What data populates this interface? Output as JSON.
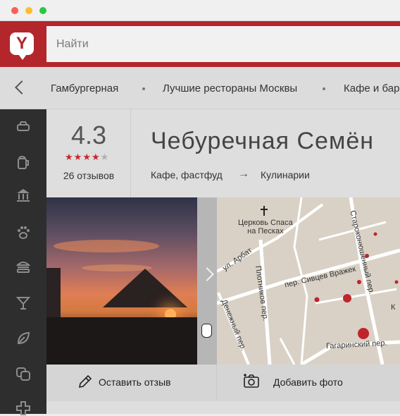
{
  "window": {
    "controls": [
      "close",
      "minimize",
      "maximize"
    ]
  },
  "header": {
    "logo_letter": "Y",
    "search_placeholder": "Найти",
    "brand_color": "#b3262b"
  },
  "breadcrumbs": {
    "items": [
      "Гамбургерная",
      "Лучшие рестораны Москвы",
      "Кафе и бар"
    ]
  },
  "sidebar": {
    "icons": [
      "car-icon",
      "beer-icon",
      "museum-icon",
      "paw-icon",
      "burger-icon",
      "cocktail-icon",
      "leaf-icon",
      "theater-icon",
      "plus-icon"
    ]
  },
  "place": {
    "rating": "4.3",
    "stars": {
      "filled": 4,
      "total": 5
    },
    "reviews": "26 отзывов",
    "title": "Чебуречная Семён",
    "category_from": "Кафе, фастфуд",
    "category_arrow": "→",
    "category_to": "Кулинарии"
  },
  "map": {
    "labels": {
      "church": "Церковь Спаса\nна Песках",
      "arbat": "ул. Арбат",
      "plotnikov": "Плотников пер.",
      "sivtsev": "пер. Сивцев Вражек",
      "denezhny": "Денежный пер.",
      "gagarinsky": "Гагаринский пер.",
      "starokonyush": "Староконюшенный пер.",
      "k": "К"
    }
  },
  "actions": {
    "review": "Оставить отзыв",
    "photo": "Добавить фото"
  }
}
